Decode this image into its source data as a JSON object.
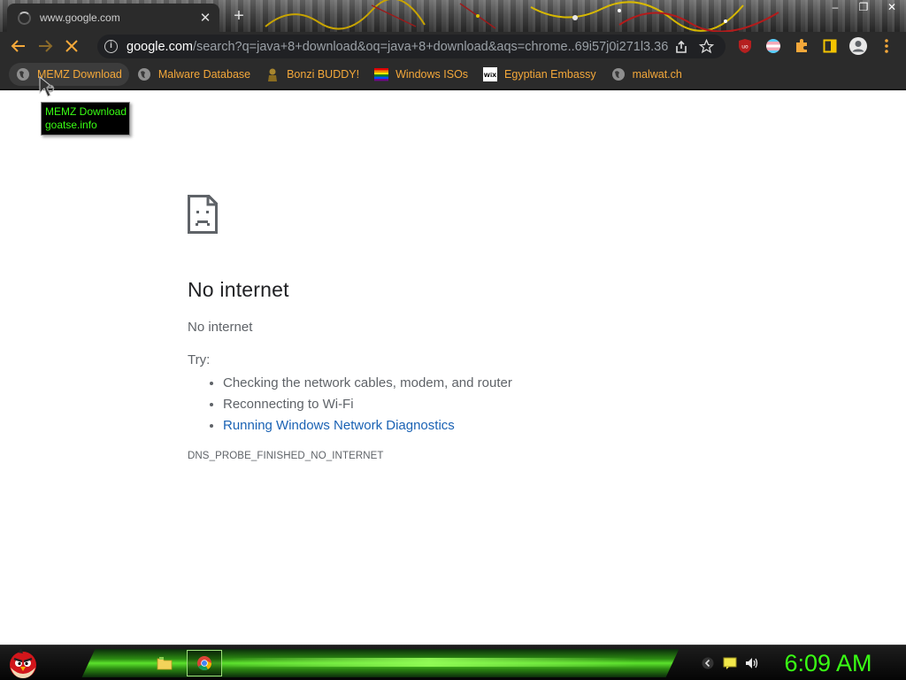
{
  "browser": {
    "tab": {
      "title": "www.google.com",
      "close_glyph": "✕"
    },
    "newtab_glyph": "+",
    "window_controls": [
      "–",
      "❐",
      "✕"
    ],
    "omnibox": {
      "host": "google.com",
      "path": "/search?q=java+8+download&oq=java+8+download&aqs=chrome..69i57j0i271l3.36..."
    },
    "icons": {
      "back": "arrow-left-icon",
      "forward": "arrow-right-icon",
      "reload": "stop-loading-icon",
      "info": "info-icon",
      "share": "share-icon",
      "bookmark": "star-icon",
      "extensions": [
        "ublock-icon",
        "flag-extension-icon",
        "puzzle-icon",
        "sidepanel-icon",
        "profile-icon",
        "menu-icon"
      ]
    },
    "accent": "#f4a83a"
  },
  "bookmarks": [
    {
      "label": "MEMZ Download",
      "icon": "globe-icon"
    },
    {
      "label": "Malware Database",
      "icon": "globe-icon"
    },
    {
      "label": "Bonzi BUDDY!",
      "icon": "bonzi-icon"
    },
    {
      "label": "Windows ISOs",
      "icon": "windows-stripes-icon"
    },
    {
      "label": "Egyptian Embassy",
      "icon": "wix-icon"
    },
    {
      "label": "malwat.ch",
      "icon": "globe-icon"
    }
  ],
  "tooltip": {
    "line1": "MEMZ Download",
    "line2": "goatse.info"
  },
  "error_page": {
    "title": "No internet",
    "subtitle": "No internet",
    "try_label": "Try:",
    "suggestions": [
      "Checking the network cables, modem, and router",
      "Reconnecting to Wi-Fi"
    ],
    "link": "Running Windows Network Diagnostics",
    "error_code": "DNS_PROBE_FINISHED_NO_INTERNET"
  },
  "taskbar": {
    "clock": "6:09 AM",
    "clock_color": "#39ff14",
    "items": [
      "start-angry-bird-icon",
      "explorer-folder-icon",
      "chrome-icon"
    ],
    "tray": [
      "tray-chevron-icon",
      "tray-message-icon",
      "volume-icon"
    ]
  }
}
